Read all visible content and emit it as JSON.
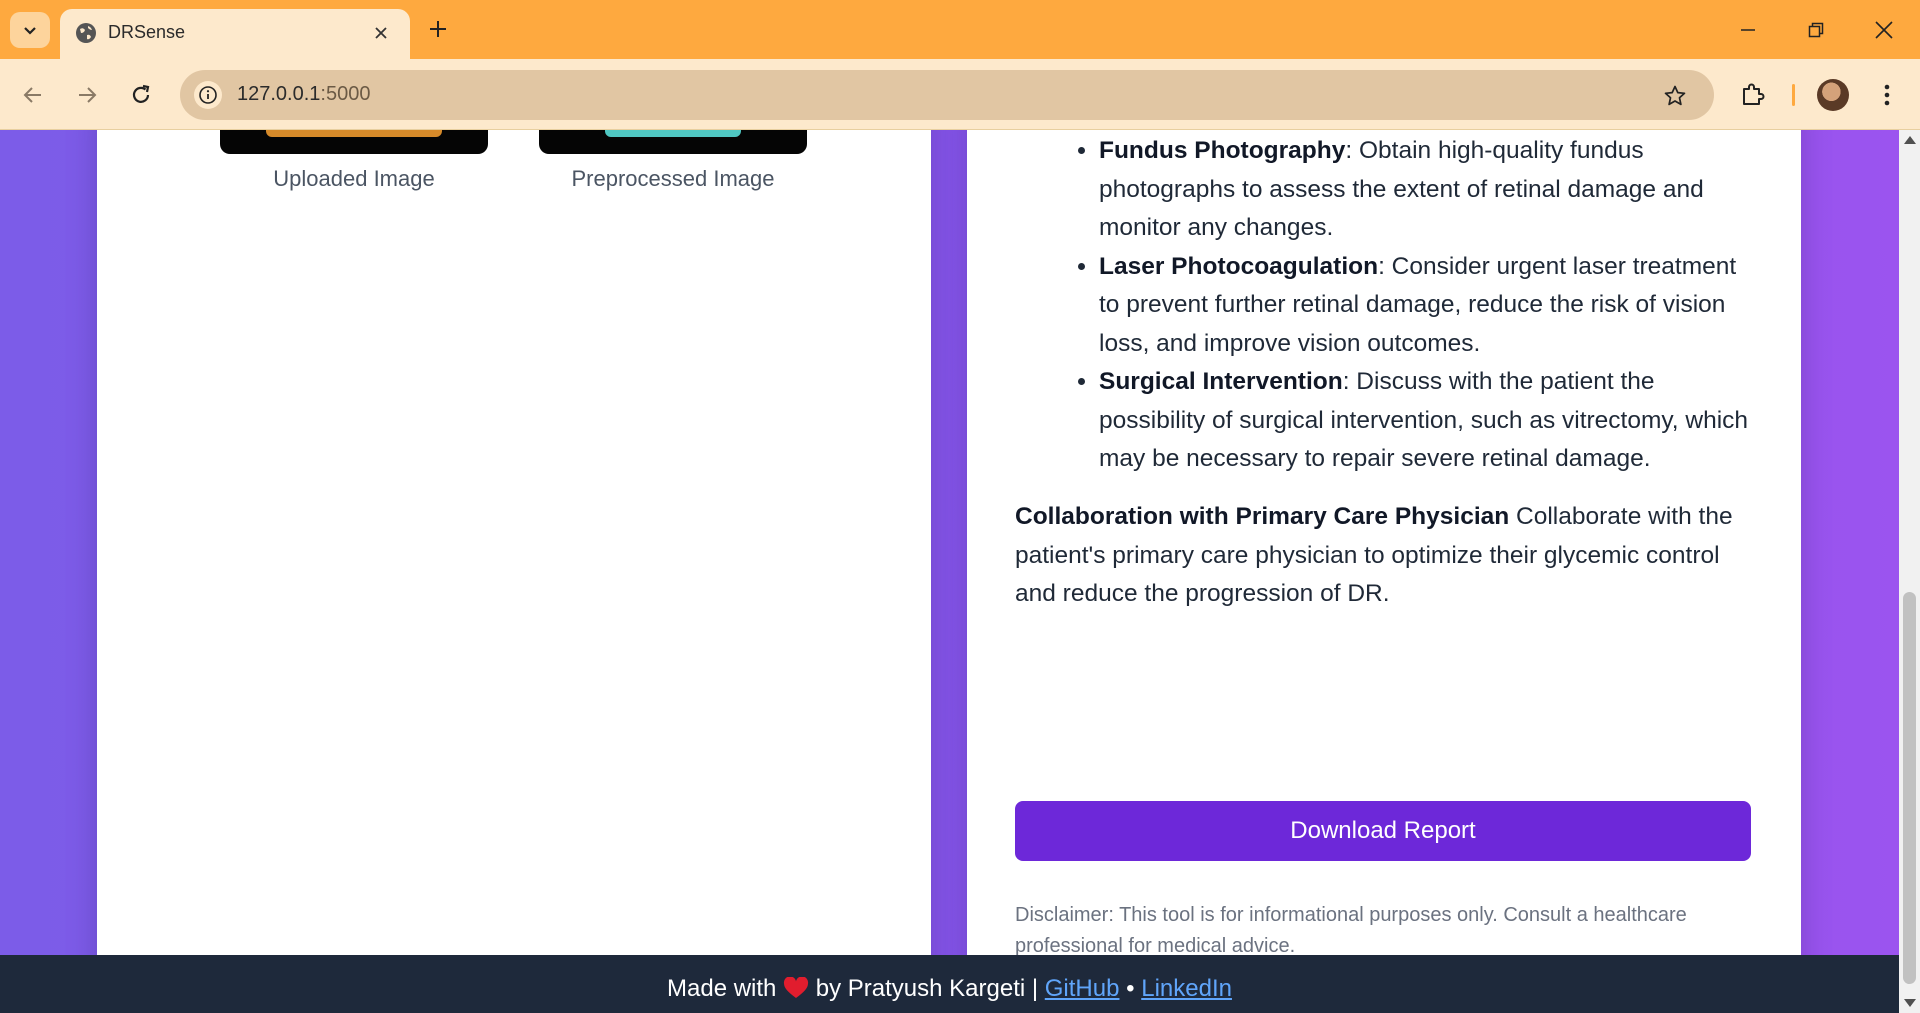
{
  "browser": {
    "tab_title": "DRSense",
    "url_host": "127.0.0.1",
    "url_port": ":5000"
  },
  "images": {
    "uploaded_caption": "Uploaded Image",
    "preprocessed_caption": "Preprocessed Image"
  },
  "report": {
    "items": [
      {
        "title": "Fundus Photography",
        "text": ": Obtain high-quality fundus photographs to assess the extent of retinal damage and monitor any changes."
      },
      {
        "title": "Laser Photocoagulation",
        "text": ": Consider urgent laser treatment to prevent further retinal damage, reduce the risk of vision loss, and improve vision outcomes."
      },
      {
        "title": "Surgical Intervention",
        "text": ": Discuss with the patient the possibility of surgical intervention, such as vitrectomy, which may be necessary to repair severe retinal damage."
      }
    ],
    "collab_title": "Collaboration with Primary Care Physician",
    "collab_text": " Collaborate with the patient's primary care physician to optimize their glycemic control and reduce the progression of DR.",
    "download_label": "Download Report",
    "disclaimer": "Disclaimer: This tool is for informational purposes only. Consult a healthcare professional for medical advice."
  },
  "footer": {
    "made_with": "Made with",
    "by_text": "by Pratyush Kargeti",
    "separator": "|",
    "github": "GitHub",
    "dot": "•",
    "linkedin": "LinkedIn"
  },
  "colors": {
    "titlebar": "#fea93f",
    "toolbar": "#fde9cc",
    "primary_button": "#6d28d9",
    "footer_bg": "#1e293b",
    "link": "#60a5fa"
  },
  "icons": [
    "chevron-down-icon",
    "globe-icon",
    "close-icon",
    "plus-icon",
    "minimize-icon",
    "restore-icon",
    "back-icon",
    "forward-icon",
    "reload-icon",
    "info-icon",
    "star-icon",
    "extensions-icon",
    "kebab-menu-icon",
    "heart-icon"
  ]
}
